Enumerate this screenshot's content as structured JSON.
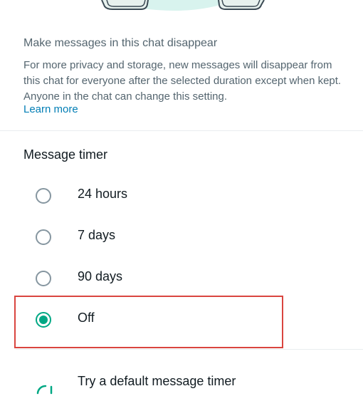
{
  "disappear": {
    "heading": "Make messages in this chat disappear",
    "description": "For more privacy and storage, new messages will disappear from this chat for everyone after the selected duration except when kept. Anyone in the chat can change this setting.",
    "learn_more": "Learn more"
  },
  "timer": {
    "title": "Message timer",
    "options": [
      {
        "label": "24 hours",
        "selected": false
      },
      {
        "label": "7 days",
        "selected": false
      },
      {
        "label": "90 days",
        "selected": false
      },
      {
        "label": "Off",
        "selected": true
      }
    ]
  },
  "default_timer": {
    "title": "Try a default message timer"
  },
  "colors": {
    "accent": "#00a884",
    "link": "#027eb5",
    "highlight": "#d9453f"
  }
}
